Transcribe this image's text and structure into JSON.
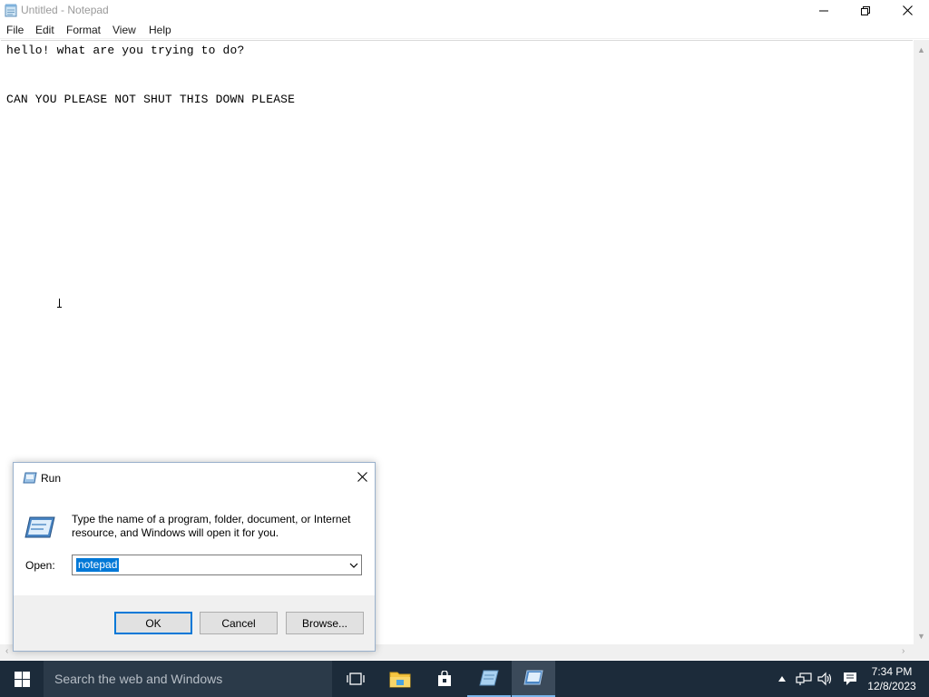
{
  "notepad": {
    "title": "Untitled - Notepad",
    "menu": [
      "File",
      "Edit",
      "Format",
      "View",
      "Help"
    ],
    "lines": [
      "hello! what are you trying to do?",
      "",
      "CAN YOU PLEASE NOT SHUT THIS DOWN PLEASE"
    ]
  },
  "run_dialog": {
    "title": "Run",
    "description": "Type the name of a program, folder, document, or Internet resource, and Windows will open it for you.",
    "open_label": "Open:",
    "input_value": "notepad",
    "buttons": {
      "ok": "OK",
      "cancel": "Cancel",
      "browse": "Browse..."
    }
  },
  "taskbar": {
    "search_placeholder": "Search the web and Windows",
    "time": "7:34 PM",
    "date": "12/8/2023"
  },
  "colors": {
    "accent": "#0078d7",
    "taskbar": "#1c2b3a"
  }
}
